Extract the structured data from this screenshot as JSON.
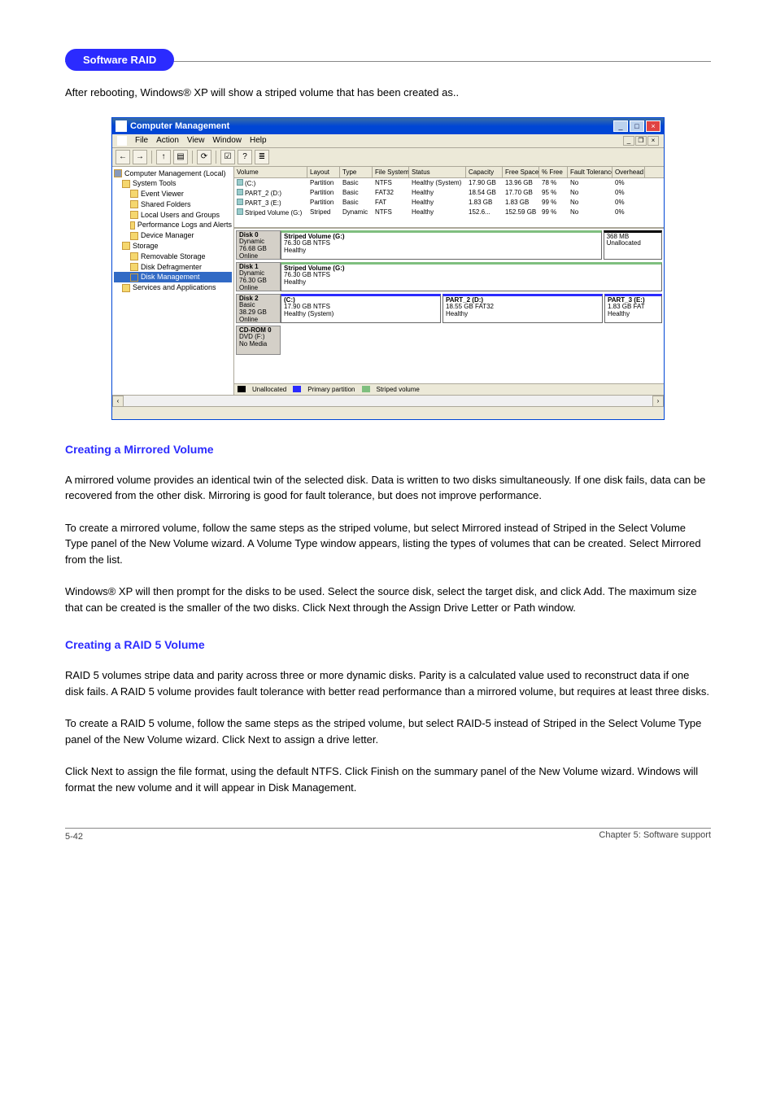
{
  "header_pill": "Software RAID",
  "intro": "After rebooting, Windows® XP will show a striped volume that has been created as..",
  "window": {
    "title": "Computer Management",
    "menus": [
      "File",
      "Action",
      "View",
      "Window",
      "Help"
    ],
    "tree": {
      "root": "Computer Management (Local)",
      "system_tools": "System Tools",
      "event_viewer": "Event Viewer",
      "shared_folders": "Shared Folders",
      "local_users": "Local Users and Groups",
      "perf_logs": "Performance Logs and Alerts",
      "device_manager": "Device Manager",
      "storage": "Storage",
      "removable_storage": "Removable Storage",
      "disk_defrag": "Disk Defragmenter",
      "disk_mgmt": "Disk Management",
      "services": "Services and Applications"
    },
    "vol_headers": [
      "Volume",
      "Layout",
      "Type",
      "File System",
      "Status",
      "Capacity",
      "Free Space",
      "% Free",
      "Fault Tolerance",
      "Overhead"
    ],
    "volumes": [
      {
        "name": "(C:)",
        "layout": "Partition",
        "type": "Basic",
        "fs": "NTFS",
        "status": "Healthy (System)",
        "cap": "17.90 GB",
        "free": "13.96 GB",
        "pct": "78 %",
        "ft": "No",
        "oh": "0%"
      },
      {
        "name": "PART_2 (D:)",
        "layout": "Partition",
        "type": "Basic",
        "fs": "FAT32",
        "status": "Healthy",
        "cap": "18.54 GB",
        "free": "17.70 GB",
        "pct": "95 %",
        "ft": "No",
        "oh": "0%"
      },
      {
        "name": "PART_3 (E:)",
        "layout": "Partition",
        "type": "Basic",
        "fs": "FAT",
        "status": "Healthy",
        "cap": "1.83 GB",
        "free": "1.83 GB",
        "pct": "99 %",
        "ft": "No",
        "oh": "0%"
      },
      {
        "name": "Striped Volume (G:)",
        "layout": "Striped",
        "type": "Dynamic",
        "fs": "NTFS",
        "status": "Healthy",
        "cap": "152.6...",
        "free": "152.59 GB",
        "pct": "99 %",
        "ft": "No",
        "oh": "0%"
      }
    ],
    "disks": [
      {
        "id": "Disk 0",
        "kind": "Dynamic",
        "size": "76.68 GB",
        "state": "Online",
        "parts": [
          {
            "label": "Striped Volume (G:)",
            "sub": "76.30 GB NTFS",
            "stat": "Healthy",
            "cls": "striped",
            "flex": "6"
          },
          {
            "label": "",
            "sub": "368 MB",
            "stat": "Unallocated",
            "cls": "unalloc",
            "flex": "1"
          }
        ]
      },
      {
        "id": "Disk 1",
        "kind": "Dynamic",
        "size": "76.30 GB",
        "state": "Online",
        "parts": [
          {
            "label": "Striped Volume (G:)",
            "sub": "76.30 GB NTFS",
            "stat": "Healthy",
            "cls": "striped",
            "flex": "1"
          }
        ]
      },
      {
        "id": "Disk 2",
        "kind": "Basic",
        "size": "38.29 GB",
        "state": "Online",
        "parts": [
          {
            "label": "(C:)",
            "sub": "17.90 GB NTFS",
            "stat": "Healthy (System)",
            "cls": "primary",
            "flex": "3"
          },
          {
            "label": "PART_2 (D:)",
            "sub": "18.55 GB FAT32",
            "stat": "Healthy",
            "cls": "primary",
            "flex": "3"
          },
          {
            "label": "PART_3 (E:)",
            "sub": "1.83 GB FAT",
            "stat": "Healthy",
            "cls": "primary",
            "flex": "1"
          }
        ]
      },
      {
        "id": "CD-ROM 0",
        "kind": "DVD (F:)",
        "size": "",
        "state": "No Media",
        "parts": []
      }
    ],
    "legend": {
      "unallocated": "Unallocated",
      "primary": "Primary partition",
      "striped": "Striped volume"
    }
  },
  "sections": {
    "mirrored_heading": "Creating a Mirrored Volume",
    "mirrored_p1": "A mirrored volume provides an identical twin of the selected disk. Data is written to two disks simultaneously. If one disk fails, data can be recovered from the other disk. Mirroring is good for fault tolerance, but does not improve performance.",
    "mirrored_p2": "To create a mirrored volume, follow the same steps as the striped volume, but select Mirrored instead of Striped in the Select Volume Type panel of the New Volume wizard. A Volume Type window appears, listing the types of volumes that can be created. Select Mirrored from the list.",
    "mirrored_p3": "Windows® XP will then prompt for the disks to be used. Select the source disk, select the target disk, and click Add. The maximum size that can be created is the smaller of the two disks. Click Next through the Assign Drive Letter or Path window.",
    "raid5_heading": "Creating a RAID 5 Volume",
    "raid5_p1": "RAID 5 volumes stripe data and parity across three or more dynamic disks. Parity is a calculated value used to reconstruct data if one disk fails. A RAID 5 volume provides fault tolerance with better read performance than a mirrored volume, but requires at least three disks.",
    "raid5_p2": "To create a RAID 5 volume, follow the same steps as the striped volume, but select RAID-5 instead of Striped in the Select Volume Type panel of the New Volume wizard. Click Next to assign a drive letter.",
    "raid5_p3": "Click Next to assign the file format, using the default NTFS. Click Finish on the summary panel of the New Volume wizard. Windows will format the new volume and it will appear in Disk Management."
  },
  "footer": {
    "page": "5-42",
    "chapter": "Chapter 5: Software support"
  }
}
